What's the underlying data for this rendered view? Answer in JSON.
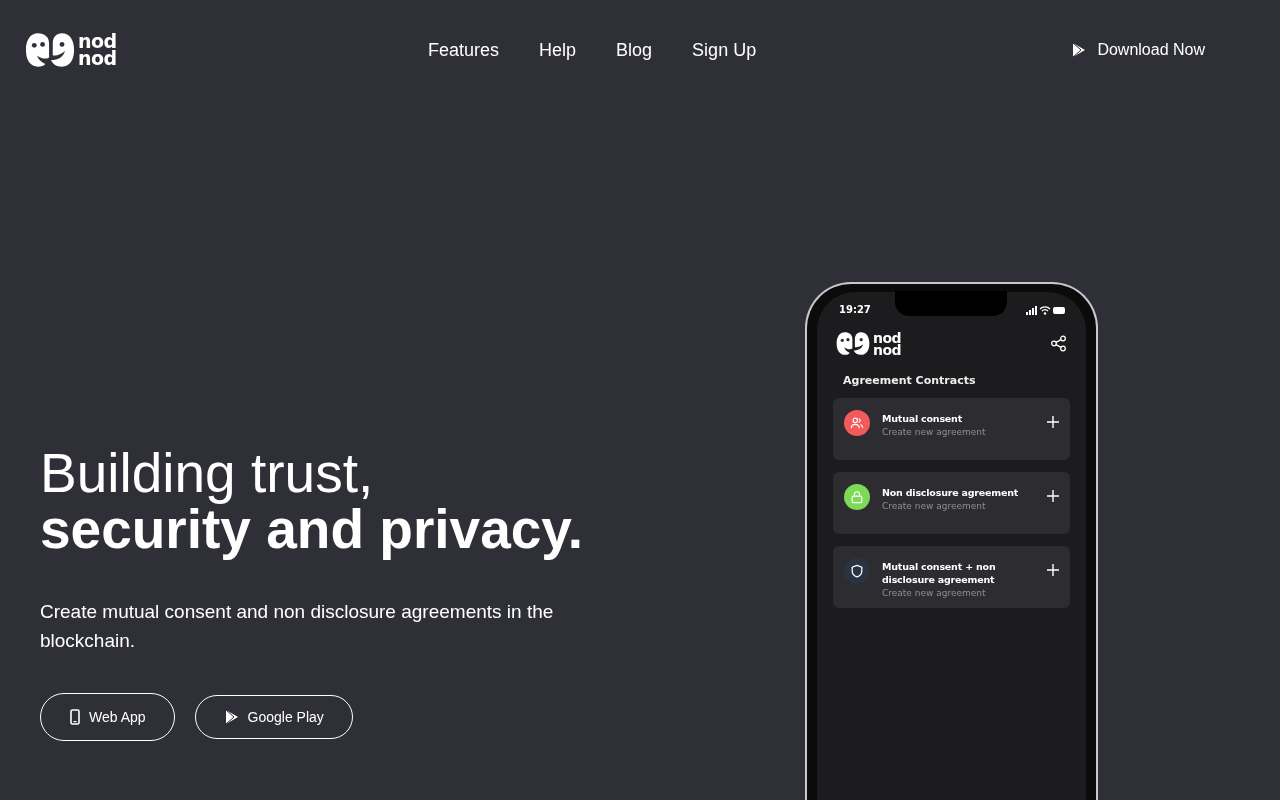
{
  "logo": {
    "lines": [
      "nod",
      "nod"
    ]
  },
  "nav": [
    {
      "label": "Features"
    },
    {
      "label": "Help"
    },
    {
      "label": "Blog"
    },
    {
      "label": "Sign Up"
    }
  ],
  "download": {
    "label": "Download Now"
  },
  "hero": {
    "title_line1": "Building trust,",
    "title_line2": "security and privacy.",
    "subtitle": "Create mutual consent and non disclosure agreements in the blockchain.",
    "buttons": [
      {
        "label": "Web App",
        "kind": "phone"
      },
      {
        "label": "Google Play",
        "kind": "play"
      }
    ]
  },
  "phone": {
    "time": "19:27",
    "logo_lines": [
      "nod",
      "nod"
    ],
    "section_title": "Agreement Contracts",
    "cards": [
      {
        "title": "Mutual consent",
        "subtitle": "Create new agreement",
        "kind": "people",
        "color": "#f25b5b"
      },
      {
        "title": "Non disclosure agreement",
        "subtitle": "Create new agreement",
        "kind": "lock",
        "color": "#7ed957"
      },
      {
        "title": "Mutual consent + non disclosure agreement",
        "subtitle": "Create new agreement",
        "kind": "shield",
        "color": "#2a3342"
      }
    ]
  }
}
